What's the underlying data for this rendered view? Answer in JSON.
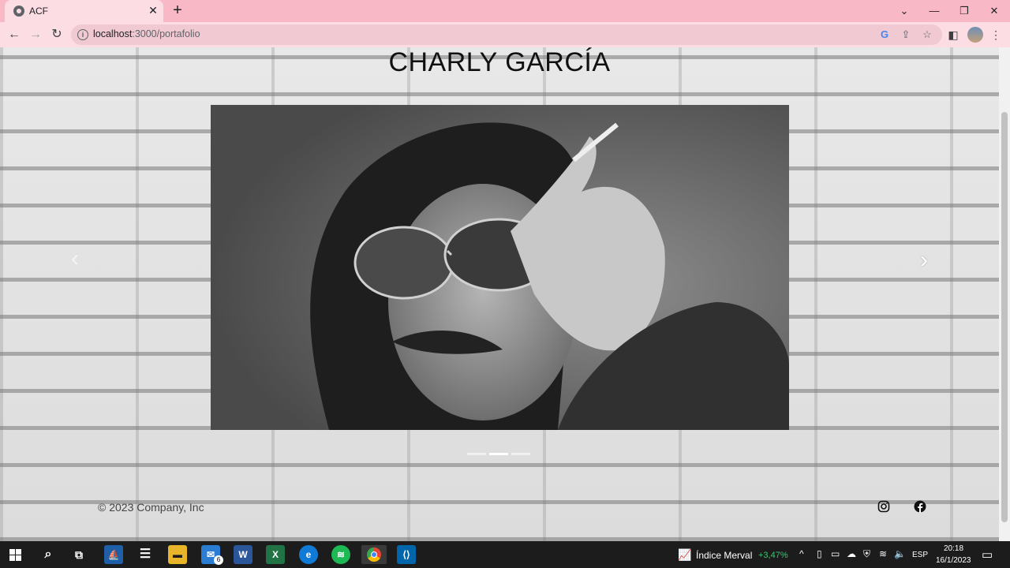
{
  "browser": {
    "tab_title": "ACF",
    "tab_close": "✕",
    "new_tab": "+",
    "url_host": "localhost",
    "url_path": ":3000/portafolio",
    "window_controls": {
      "dropdown": "⌄",
      "minimize": "—",
      "restore": "❐",
      "close": "✕"
    },
    "nav": {
      "back": "←",
      "forward": "→",
      "reload": "↻"
    },
    "icons": [
      "google-lens-icon",
      "share-icon",
      "bookmark-star-icon",
      "side-panel-icon",
      "profile-avatar",
      "kebab-menu-icon"
    ]
  },
  "page": {
    "title": "CHARLY GARCÍA",
    "carousel": {
      "prev": "‹",
      "next": "›",
      "slide_count": 3,
      "active_index": 1,
      "image_alt": "Black and white portrait photograph"
    },
    "footer": {
      "copyright": "© 2023 Company, Inc",
      "social": [
        "instagram-icon",
        "facebook-icon"
      ]
    }
  },
  "taskbar": {
    "mail_badge": "6",
    "merval_label": "Índice Merval",
    "merval_change": "+3,47%",
    "language": "ESP",
    "time": "20:18",
    "date": "16/1/2023",
    "colors": {
      "positive": "#37c871",
      "taskbar": "#1c1c1c"
    }
  }
}
